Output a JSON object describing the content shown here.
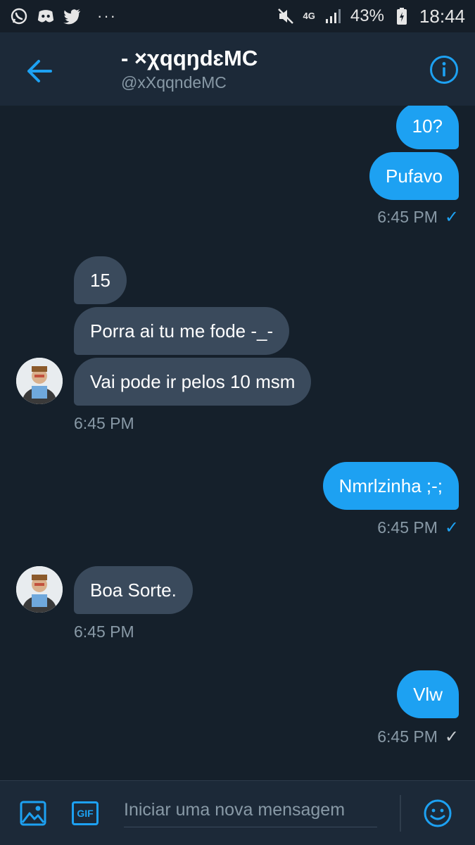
{
  "status_bar": {
    "dots": "···",
    "signal_label": "4G",
    "battery": "43%",
    "time": "18:44"
  },
  "header": {
    "name": "- ×χqqŋdɛMC",
    "handle": "@xXqqndeMC"
  },
  "messages": [
    {
      "direction": "out",
      "text": "10?"
    },
    {
      "direction": "out",
      "text": "Pufavo"
    },
    {
      "direction": "out-ts",
      "time": "6:45 PM",
      "check": "✓",
      "check_color": "#1da1f2"
    },
    {
      "direction": "in",
      "text": "15"
    },
    {
      "direction": "in",
      "text": "Porra ai tu me fode -_-"
    },
    {
      "direction": "in",
      "text": "Vai pode ir pelos 10 msm"
    },
    {
      "direction": "in-ts",
      "time": "6:45 PM"
    },
    {
      "direction": "out",
      "text": "Nmrlzinha ;-;"
    },
    {
      "direction": "out-ts",
      "time": "6:45 PM",
      "check": "✓",
      "check_color": "#1da1f2"
    },
    {
      "direction": "in",
      "text": "Boa Sorte."
    },
    {
      "direction": "in-ts",
      "time": "6:45 PM"
    },
    {
      "direction": "out",
      "text": "Vlw"
    },
    {
      "direction": "out-ts",
      "time": "6:45 PM",
      "check": "✓",
      "check_color": "#c8ccd0"
    }
  ],
  "composer": {
    "placeholder": "Iniciar uma nova mensagem",
    "gif_label": "GIF",
    "icons": [
      "image-icon",
      "gif-icon",
      "emoji-icon"
    ]
  },
  "colors": {
    "accent": "#1da1f2",
    "background": "#15202b",
    "incoming_bubble": "#3a4a5c",
    "secondary_text": "#8899a6"
  }
}
